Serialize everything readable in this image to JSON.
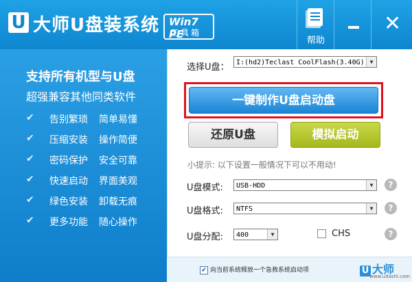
{
  "titlebar": {
    "logo_letter": "U",
    "app_title": "大师U盘装系统",
    "badge_line1": "Win7 PE",
    "badge_line2": "工具箱",
    "help_label": "帮助",
    "close_glyph": "✕"
  },
  "left": {
    "headline": "支持所有机型与U盘",
    "subline": "超强兼容其他同类软件",
    "features": [
      {
        "a": "告别繁琐",
        "b": "简单易懂"
      },
      {
        "a": "压缩安装",
        "b": "操作简便"
      },
      {
        "a": "密码保护",
        "b": "安全可靠"
      },
      {
        "a": "快速启动",
        "b": "界面美观"
      },
      {
        "a": "绿色安装",
        "b": "卸载无痕"
      },
      {
        "a": "更多功能",
        "b": "随心操作"
      }
    ],
    "check_glyph": "✔"
  },
  "right": {
    "select_label": "选择U盘：",
    "select_value": "I:(hd2)Teclast CoolFlash(3.40G)",
    "make_button": "一键制作U盘启动盘",
    "restore_button": "还原U盘",
    "simulate_button": "模拟启动",
    "tip": "小提示: 以下设置一般情况下可以不用动!",
    "mode_label": "U盘模式:",
    "mode_value": "USB-HDD",
    "format_label": "U盘格式:",
    "format_value": "NTFS",
    "alloc_label": "U盘分配:",
    "alloc_value": "400",
    "chs_label": "CHS",
    "help_glyph": "?",
    "arrow_glyph": "▼"
  },
  "bottom": {
    "checkbox_text": "向当前系统释放一个急救系统启动项",
    "check_glyph": "✔",
    "brand_letter": "U",
    "brand_name": "大师",
    "brand_url": "www.udashi.com"
  },
  "colors": {
    "titlebar": "#1295d9",
    "left_panel": "#1c8ed6",
    "make_button": "#3d9fe8",
    "simulate_button": "#b4c52a",
    "highlight_frame": "#e0101e"
  }
}
